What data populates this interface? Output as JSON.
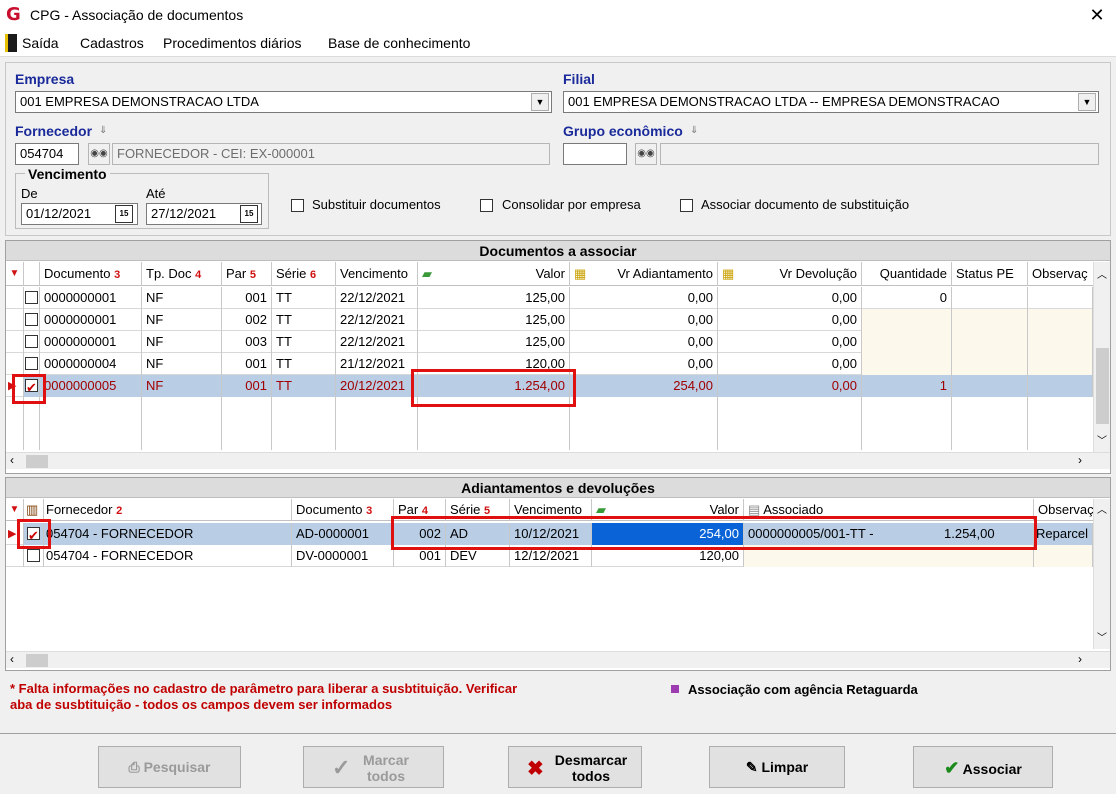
{
  "window": {
    "title": "CPG - Associação de documentos",
    "logo_text": "G"
  },
  "menu": [
    "Saída",
    "Cadastros",
    "Procedimentos diários",
    "Base de conhecimento"
  ],
  "filters": {
    "empresa_label": "Empresa",
    "empresa_value": "001 EMPRESA DEMONSTRACAO LTDA",
    "filial_label": "Filial",
    "filial_value": "001 EMPRESA DEMONSTRACAO LTDA -- EMPRESA DEMONSTRACAO",
    "fornecedor_label": "Fornecedor",
    "fornecedor_code": "054704",
    "fornecedor_name": "FORNECEDOR - CEI: EX-000001",
    "grupo_label": "Grupo econômico",
    "grupo_code": "",
    "grupo_name": "",
    "vencimento_label": "Vencimento",
    "de_label": "De",
    "de_value": "01/12/2021",
    "ate_label": "Até",
    "ate_value": "27/12/2021",
    "cal_glyph": "15",
    "opt_substituir": "Substituir documentos",
    "opt_consolidar": "Consolidar por empresa",
    "opt_associar": "Associar documento de substituição"
  },
  "docs": {
    "title": "Documentos a associar",
    "headers": [
      "Documento",
      "Tp. Doc",
      "Par",
      "Série",
      "Vencimento",
      "Valor",
      "Vr Adiantamento",
      "Vr Devolução",
      "Quantidade",
      "Status PE",
      "Observaç"
    ],
    "sort_orders": [
      "3",
      "4",
      "5",
      "6"
    ],
    "rows": [
      {
        "checked": false,
        "doc": "0000000001",
        "tp": "NF",
        "par": "001",
        "serie": "TT",
        "venc": "22/12/2021",
        "valor": "125,00",
        "adiant": "0,00",
        "devol": "0,00",
        "qtd": "0"
      },
      {
        "checked": false,
        "doc": "0000000001",
        "tp": "NF",
        "par": "002",
        "serie": "TT",
        "venc": "22/12/2021",
        "valor": "125,00",
        "adiant": "0,00",
        "devol": "0,00",
        "qtd": ""
      },
      {
        "checked": false,
        "doc": "0000000001",
        "tp": "NF",
        "par": "003",
        "serie": "TT",
        "venc": "22/12/2021",
        "valor": "125,00",
        "adiant": "0,00",
        "devol": "0,00",
        "qtd": ""
      },
      {
        "checked": false,
        "doc": "0000000004",
        "tp": "NF",
        "par": "001",
        "serie": "TT",
        "venc": "21/12/2021",
        "valor": "120,00",
        "adiant": "0,00",
        "devol": "0,00",
        "qtd": ""
      },
      {
        "checked": true,
        "doc": "0000000005",
        "tp": "NF",
        "par": "001",
        "serie": "TT",
        "venc": "20/12/2021",
        "valor": "1.254,00",
        "adiant": "254,00",
        "devol": "0,00",
        "qtd": "1"
      }
    ]
  },
  "adv": {
    "title": "Adiantamentos e devoluções",
    "headers": [
      "Fornecedor",
      "Documento",
      "Par",
      "Série",
      "Vencimento",
      "Valor",
      "Associado",
      "Observaç"
    ],
    "sort_orders": [
      "2",
      "3",
      "4",
      "5"
    ],
    "rows": [
      {
        "checked": true,
        "forn": "054704 - FORNECEDOR",
        "doc": "AD-0000001",
        "par": "002",
        "serie": "AD",
        "venc": "10/12/2021",
        "valor": "254,00",
        "assoc": "0000000005/001-TT   -",
        "assoc_val": "1.254,00",
        "obs": "Reparcel"
      },
      {
        "checked": false,
        "forn": "054704 - FORNECEDOR",
        "doc": "DV-0000001",
        "par": "001",
        "serie": "DEV",
        "venc": "12/12/2021",
        "valor": "120,00",
        "assoc": "",
        "assoc_val": "",
        "obs": ""
      }
    ]
  },
  "notes": {
    "warning_line1": "* Falta informações no cadastro de parâmetro para liberar a susbtituição. Verificar",
    "warning_line2": "aba de susbtituição - todos os campos devem ser informados",
    "legend": "Associação com agência Retaguarda"
  },
  "buttons": {
    "pesquisar": "Pesquisar",
    "marcar_1": "Marcar",
    "marcar_2": "todos",
    "desmarcar_1": "Desmarcar",
    "desmarcar_2": "todos",
    "limpar": "Limpar",
    "associar": "Associar"
  },
  "colors": {
    "accent_red": "#e01010",
    "selection": "#b9cde5",
    "focus_blue": "#0a64d8"
  }
}
